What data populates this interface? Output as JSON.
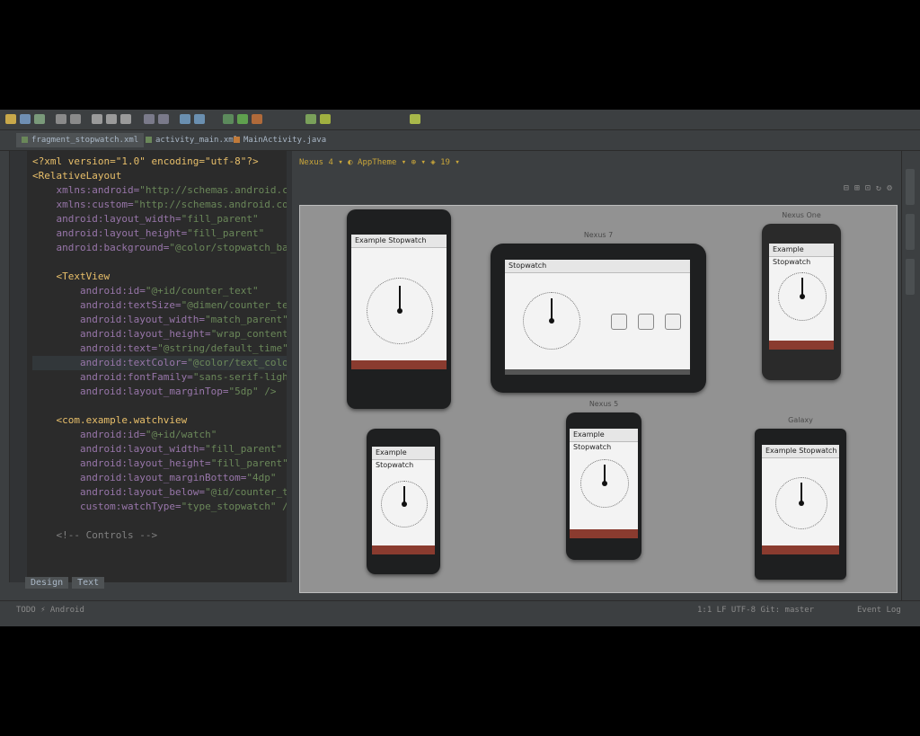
{
  "toolbar": {
    "icons": [
      "open-icon",
      "save-icon",
      "sync-icon",
      "undo-icon",
      "redo-icon",
      "cut-icon",
      "copy-icon",
      "paste-icon",
      "search-icon",
      "replace-icon",
      "back-icon",
      "forward-icon",
      "build-icon",
      "run-icon",
      "debug-icon",
      "sdk-manager-icon",
      "avd-manager-icon",
      "help-icon"
    ]
  },
  "editor_tabs": [
    {
      "label": "fragment_stopwatch.xml",
      "active": true
    },
    {
      "label": "activity_main.xml",
      "active": false
    },
    {
      "label": "MainActivity.java",
      "active": false
    }
  ],
  "code": {
    "lines": [
      {
        "tag": "<?xml version=\"1.0\" encoding=\"utf-8\"?>",
        "attr": "",
        "val": ""
      },
      {
        "tag": "<RelativeLayout",
        "attr": "",
        "val": ""
      },
      {
        "tag": "",
        "attr": "    xmlns:android=",
        "val": "\"http://schemas.android.com/apk/res/android\""
      },
      {
        "tag": "",
        "attr": "    xmlns:custom=",
        "val": "\"http://schemas.android.com/apk/res-auto\""
      },
      {
        "tag": "",
        "attr": "    android:layout_width=",
        "val": "\"fill_parent\""
      },
      {
        "tag": "",
        "attr": "    android:layout_height=",
        "val": "\"fill_parent\""
      },
      {
        "tag": "",
        "attr": "    android:background=",
        "val": "\"@color/stopwatch_background\">"
      },
      {
        "tag": "",
        "attr": "",
        "val": ""
      },
      {
        "tag": "    <TextView",
        "attr": "",
        "val": ""
      },
      {
        "tag": "",
        "attr": "        android:id=",
        "val": "\"@+id/counter_text\""
      },
      {
        "tag": "",
        "attr": "        android:textSize=",
        "val": "\"@dimen/counter_text_size\""
      },
      {
        "tag": "",
        "attr": "        android:layout_width=",
        "val": "\"match_parent\""
      },
      {
        "tag": "",
        "attr": "        android:layout_height=",
        "val": "\"wrap_content\""
      },
      {
        "tag": "",
        "attr": "        android:text=",
        "val": "\"@string/default_time\""
      },
      {
        "tag": "",
        "attr": "        android:textColor=",
        "val": "\"@color/text_color\""
      },
      {
        "tag": "",
        "attr": "        android:fontFamily=",
        "val": "\"sans-serif-light\""
      },
      {
        "tag": "",
        "attr": "        android:layout_marginTop=",
        "val": "\"5dp\" />"
      },
      {
        "tag": "",
        "attr": "",
        "val": ""
      },
      {
        "tag": "    <com.example.watchview",
        "attr": "",
        "val": ""
      },
      {
        "tag": "",
        "attr": "        android:id=",
        "val": "\"@+id/watch\""
      },
      {
        "tag": "",
        "attr": "        android:layout_width=",
        "val": "\"fill_parent\""
      },
      {
        "tag": "",
        "attr": "        android:layout_height=",
        "val": "\"fill_parent\""
      },
      {
        "tag": "",
        "attr": "        android:layout_marginBottom=",
        "val": "\"4dp\""
      },
      {
        "tag": "",
        "attr": "        android:layout_below=",
        "val": "\"@id/counter_text\""
      },
      {
        "tag": "",
        "attr": "        custom:watchType=",
        "val": "\"type_stopwatch\" />"
      },
      {
        "tag": "",
        "attr": "",
        "val": ""
      },
      {
        "tag": "    <!-- Controls -->",
        "attr": "",
        "val": ""
      }
    ]
  },
  "preview": {
    "toolbar_text": "Nexus 4 ▾   ◐ AppTheme ▾   ⊕ ▾   ◈ 19 ▾",
    "zoom_icons": "⊟ ⊞ ⊡ ↻ ⚙"
  },
  "devices": [
    {
      "label": "",
      "title": "Example Stopwatch"
    },
    {
      "label": "Nexus 7",
      "title": "Stopwatch"
    },
    {
      "label": "Nexus One",
      "title": "Example Stopwatch"
    },
    {
      "label": "",
      "title": "Example Stopwatch"
    },
    {
      "label": "Nexus 5",
      "title": "Example Stopwatch"
    },
    {
      "label": "Galaxy",
      "title": "Example Stopwatch"
    }
  ],
  "bottom_tabs": [
    "Design",
    "Text"
  ],
  "status": {
    "left": "TODO   ⚡ Android",
    "right": "1:1   LF   UTF-8   Git: master",
    "event_log": "Event Log"
  },
  "colors": {
    "ide_bg": "#3c3f41",
    "editor_bg": "#2b2b2b",
    "canvas_bg": "#929292",
    "button_bar": "#8a3b2f"
  }
}
